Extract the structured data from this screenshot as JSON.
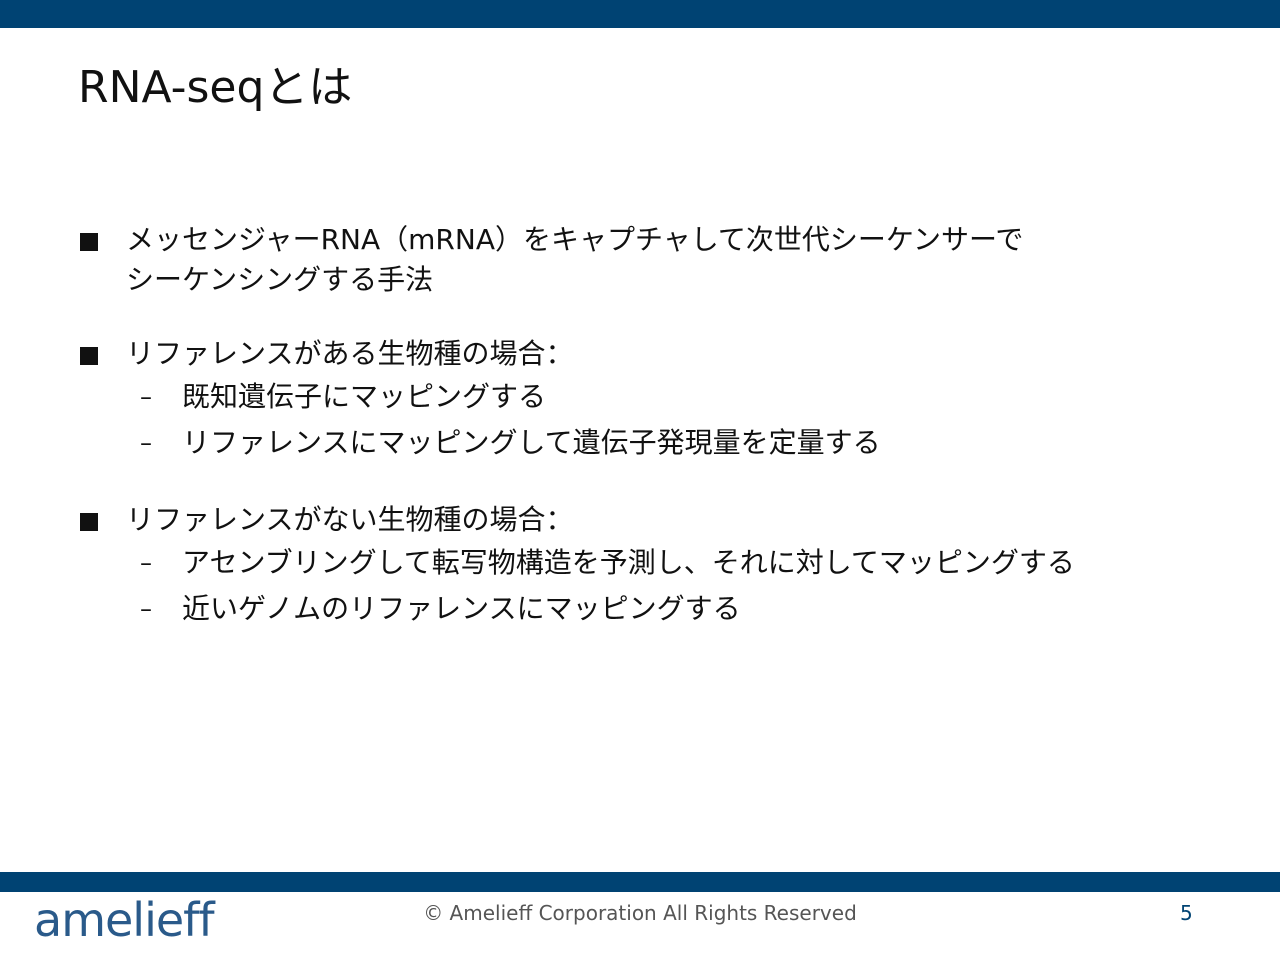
{
  "slide": {
    "title": "RNA-seqとは",
    "bullets": [
      {
        "text": "メッセンジャーRNA（mRNA）をキャプチャして次世代シーケンサーで\nシーケンシングする手法",
        "subs": []
      },
      {
        "text": "リファレンスがある生物種の場合：",
        "subs": [
          "既知遺伝子にマッピングする",
          "リファレンスにマッピングして遺伝子発現量を定量する"
        ]
      },
      {
        "text": "リファレンスがない生物種の場合：",
        "subs": [
          "アセンブリングして転写物構造を予測し、それに対してマッピングする",
          "近いゲノムのリファレンスにマッピングする"
        ]
      }
    ],
    "dash": "–"
  },
  "footer": {
    "logo": "amelieff",
    "copyright": "© Amelieff Corporation All Rights Reserved",
    "page_number": "5"
  },
  "colors": {
    "brand_bar": "#004373",
    "logo": "#2a5a8a"
  }
}
